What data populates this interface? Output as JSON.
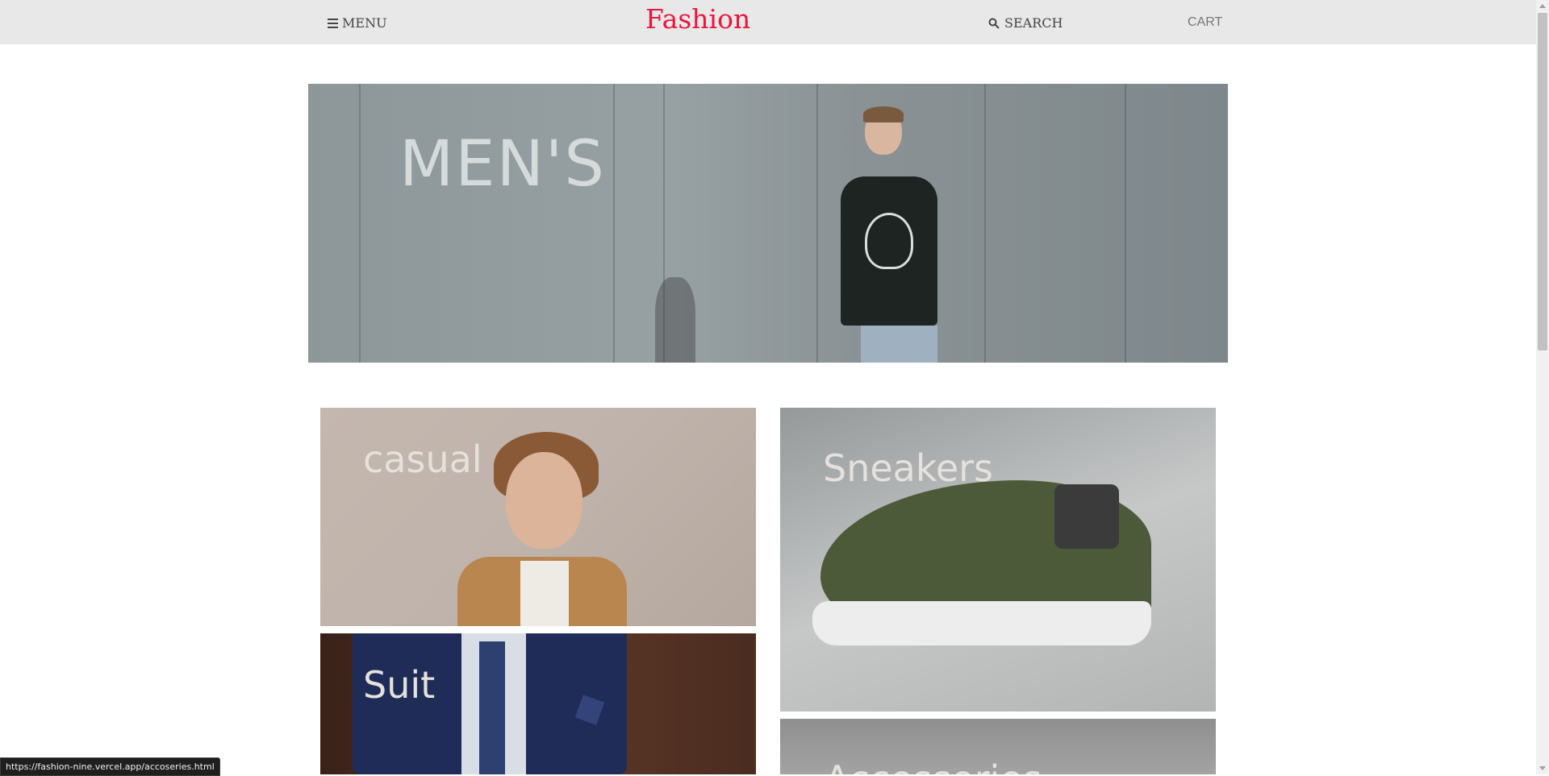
{
  "header": {
    "menu_label": "MENU",
    "logo": "Fashion",
    "search_label": "SEARCH",
    "cart_label": "CART"
  },
  "hero": {
    "title": "MEN'S"
  },
  "categories": [
    {
      "label": "casual"
    },
    {
      "label": "Sneakers"
    },
    {
      "label": "Suit"
    },
    {
      "label": "Accessories"
    }
  ],
  "status_bar": {
    "url": "https://fashion-nine.vercel.app/accoseries.html"
  },
  "colors": {
    "logo": "#e8163f",
    "header_bg": "#e8e8e8"
  }
}
